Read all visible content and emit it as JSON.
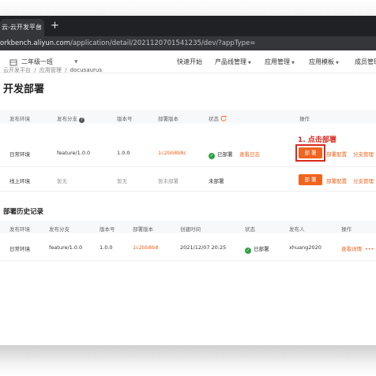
{
  "browser": {
    "tab_title": "云-云开发平台",
    "url_host": "orkbench.aliyun.com",
    "url_path": "/application/detail/20211207015412​35/dev/?appType="
  },
  "nav": {
    "org_label": "二年级一班",
    "items": [
      "快速开始",
      "产品线管理",
      "应用管理",
      "应用模板",
      "成员管理"
    ]
  },
  "breadcrumb": [
    "云开发平台",
    "/",
    "应用管理",
    "/",
    "docusaurus"
  ],
  "page_title": "开发部署",
  "env_table": {
    "headers": [
      "发布环境",
      "发布分支",
      "版本号",
      "部署版本",
      "状态",
      "操作"
    ],
    "rows": [
      {
        "env": "日常环境",
        "branch": "feature/1.0.0",
        "version": "1.0.0",
        "deploy_version": "1c2bb8b8c",
        "status": "已部署",
        "status_link": "查看日志",
        "deploy_label": "部 署",
        "link1": "部署配置",
        "link2": "分支管理"
      },
      {
        "env": "线上环境",
        "branch": "暂无",
        "version": "暂无",
        "deploy_version": "暂未部署",
        "status": "未部署",
        "deploy_label": "部 署",
        "link1": "部署配置",
        "link2": "分支管理"
      }
    ]
  },
  "annotation": "1. 点击部署",
  "history": {
    "title": "部署历史记录",
    "headers": [
      "发布环境",
      "发布分支",
      "版本号",
      "部署版本",
      "创建时间",
      "状态",
      "发布人",
      "操作"
    ],
    "rows": [
      {
        "env": "日常环境",
        "branch": "feature/1.0.0",
        "version": "1.0.0",
        "deploy_version": "1c2bb8b8",
        "created": "2021/12/07 20:25",
        "status": "已部署",
        "publisher": "xhuang2020",
        "op": "查看详情"
      }
    ]
  },
  "colors": {
    "accent": "#f0641e",
    "success": "#2ea042",
    "annotation": "#d9291e"
  }
}
